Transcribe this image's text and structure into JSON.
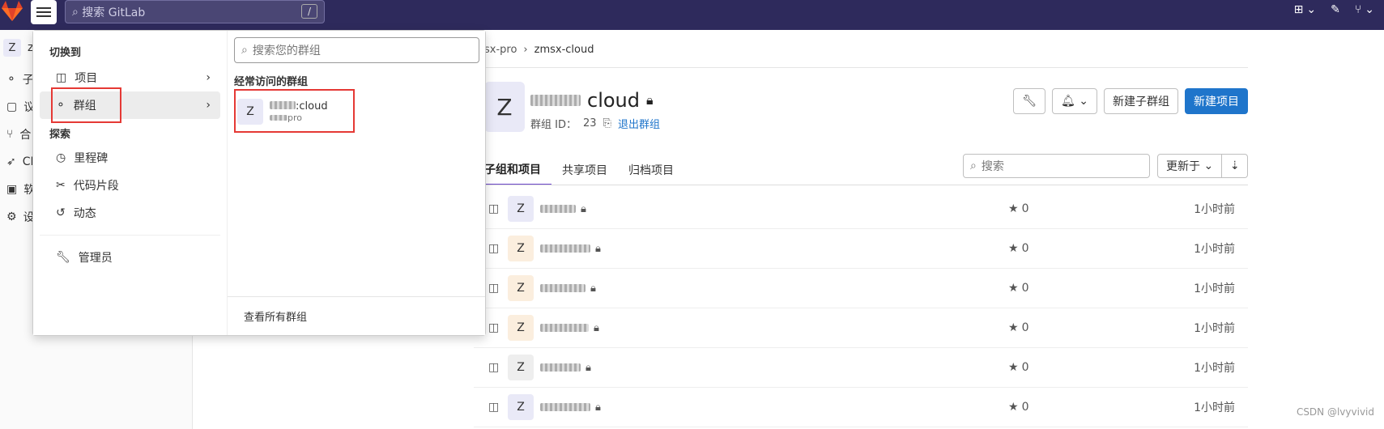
{
  "topbar": {
    "search_placeholder": "搜索 GitLab",
    "search_shortcut": "/"
  },
  "sidebar": {
    "context_avatar": "Z",
    "context_label": "z",
    "items": [
      {
        "icon": "subgroups-icon",
        "label": "子"
      },
      {
        "icon": "issues-icon",
        "label": "议"
      },
      {
        "icon": "merge-request-icon",
        "label": "合"
      },
      {
        "icon": "rocket-icon",
        "label": "CI"
      },
      {
        "icon": "package-icon",
        "label": "软"
      },
      {
        "icon": "settings-icon",
        "label": "设"
      }
    ]
  },
  "breadcrumb": {
    "parent": "sx-pro",
    "current": "zmsx-cloud"
  },
  "group": {
    "avatar": "Z",
    "title_suffix": "cloud",
    "id_label": "群组 ID：",
    "id_value": "23",
    "leave_link": "退出群组"
  },
  "actions": {
    "new_subgroup": "新建子群组",
    "new_project": "新建项目"
  },
  "tabs": [
    "子组和项目",
    "共享项目",
    "归档项目"
  ],
  "filter": {
    "placeholder": "搜索",
    "sort_label": "更新于"
  },
  "rows": [
    {
      "avatar": "Z",
      "avatar_color": "#e9e9f7",
      "stars": "0",
      "time": "1小时前"
    },
    {
      "avatar": "Z",
      "avatar_color": "#fbeede",
      "stars": "0",
      "time": "1小时前"
    },
    {
      "avatar": "Z",
      "avatar_color": "#fbeede",
      "stars": "0",
      "time": "1小时前"
    },
    {
      "avatar": "Z",
      "avatar_color": "#fbeede",
      "stars": "0",
      "time": "1小时前"
    },
    {
      "avatar": "Z",
      "avatar_color": "#eeeeee",
      "stars": "0",
      "time": "1小时前"
    },
    {
      "avatar": "Z",
      "avatar_color": "#e9e9f7",
      "stars": "0",
      "time": "1小时前"
    }
  ],
  "dropdown": {
    "switch_heading": "切换到",
    "projects": "项目",
    "groups": "群组",
    "explore_heading": "探索",
    "milestones": "里程碑",
    "snippets": "代码片段",
    "activity": "动态",
    "admin": "管理员",
    "search_placeholder": "搜索您的群组",
    "frequent_heading": "经常访问的群组",
    "frequent_group": {
      "avatar": "Z",
      "name_suffix": ":cloud",
      "path_suffix": "pro"
    },
    "view_all": "查看所有群组"
  },
  "watermark": "CSDN @lvyvivid",
  "colors": {
    "topbar": "#2e2a5c",
    "primary": "#1f75cb",
    "highlight_box": "#e53935"
  }
}
